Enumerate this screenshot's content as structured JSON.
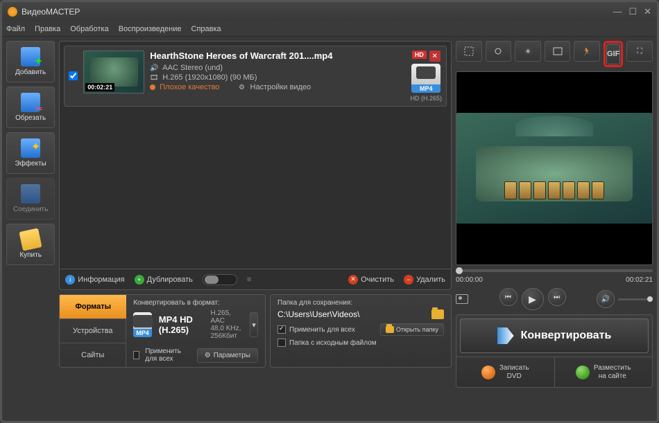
{
  "window": {
    "title": "ВидеоМАСТЕР"
  },
  "menu": [
    "Файл",
    "Правка",
    "Обработка",
    "Воспроизведение",
    "Справка"
  ],
  "sidebar": {
    "add": "Добавить",
    "trim": "Обрезать",
    "effects": "Эффекты",
    "join": "Соединить",
    "buy": "Купить"
  },
  "file": {
    "title": "HearthStone  Heroes of Warcraft 201....mp4",
    "audio": "AAC Stereo (und)",
    "video": "H.265 (1920x1080) (90 МБ)",
    "quality": "Плохое качество",
    "settings": "Настройки видео",
    "duration": "00:02:21",
    "hd": "HD",
    "ext": "MP4",
    "codec": "HD (H.265)"
  },
  "toolbar": {
    "info": "Информация",
    "dup": "Дублировать",
    "clear": "Очистить",
    "del": "Удалить"
  },
  "format": {
    "tabs": {
      "formats": "Форматы",
      "devices": "Устройства",
      "sites": "Сайты"
    },
    "header": "Конвертировать в формат:",
    "name": "MP4 HD (H.265)",
    "line1": "H.265, AAC",
    "line2": "48,0 KHz, 256Кбит",
    "apply_all": "Применить для всех",
    "params": "Параметры"
  },
  "save": {
    "header": "Папка для сохранения:",
    "path": "C:\\Users\\User\\Videos\\",
    "apply_all": "Применить для всех",
    "source": "Папка с исходным файлом",
    "open": "Открыть папку"
  },
  "tools": {
    "gif": "GIF"
  },
  "player": {
    "start": "00:00:00",
    "end": "00:02:21"
  },
  "actions": {
    "convert": "Конвертировать",
    "dvd": "Записать\nDVD",
    "publish": "Разместить\nна сайте"
  }
}
